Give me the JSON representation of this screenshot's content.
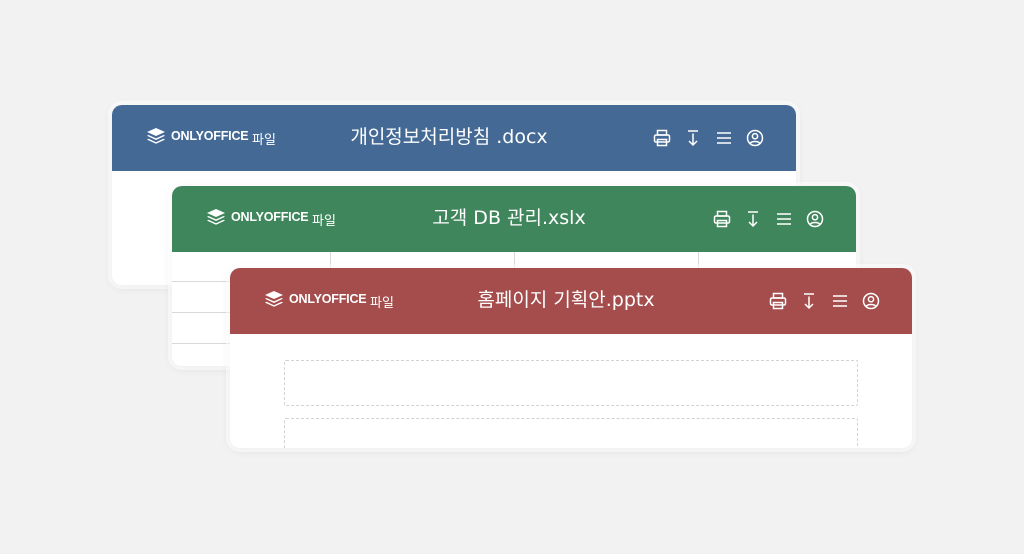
{
  "windows": [
    {
      "logo_text": "ONLYOFFICE",
      "menu": "파일",
      "title": "개인정보처리방침 .docx",
      "color": "#446995"
    },
    {
      "logo_text": "ONLYOFFICE",
      "menu": "파일",
      "title": "고객 DB 관리.xslx",
      "color": "#40865c"
    },
    {
      "logo_text": "ONLYOFFICE",
      "menu": "파일",
      "title": "홈페이지 기획안.pptx",
      "color": "#a44d4c"
    }
  ],
  "icons": [
    "layers-logo-icon",
    "print-icon",
    "download-icon",
    "menu-icon",
    "user-icon"
  ]
}
